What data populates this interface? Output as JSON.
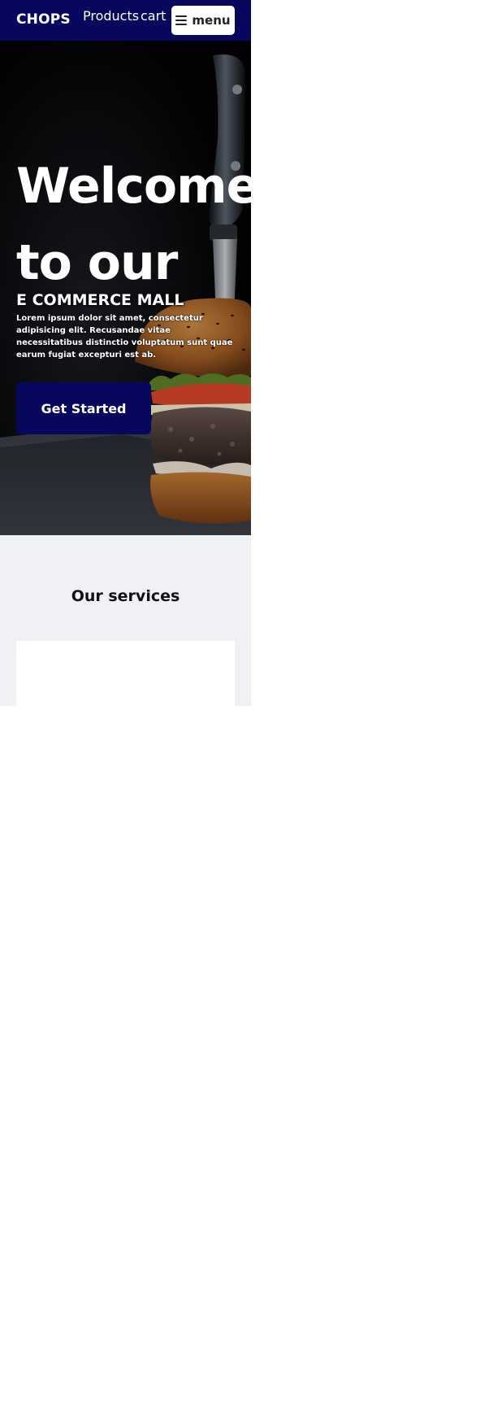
{
  "header": {
    "brand": "CHOPS",
    "nav": {
      "products": "Products",
      "cart": "cart"
    },
    "menu_button": {
      "label": "menu",
      "icon": "hamburger-icon"
    }
  },
  "hero": {
    "title": "Welcome to our",
    "subtitle": "E COMMERCE MALL",
    "text": "Lorem ipsum dolor sit amet, consectetur adipisicing elit. Recusandae vitae necessitatibus distinctio voluptatum sunt quae earum fugiat excepturi est ab.",
    "cta_label": "Get Started",
    "image": "burger-with-knife-photo"
  },
  "services": {
    "title": "Our services"
  },
  "colors": {
    "brand_navy": "#07075e",
    "section_bg": "#f0f1f6",
    "white": "#ffffff"
  }
}
